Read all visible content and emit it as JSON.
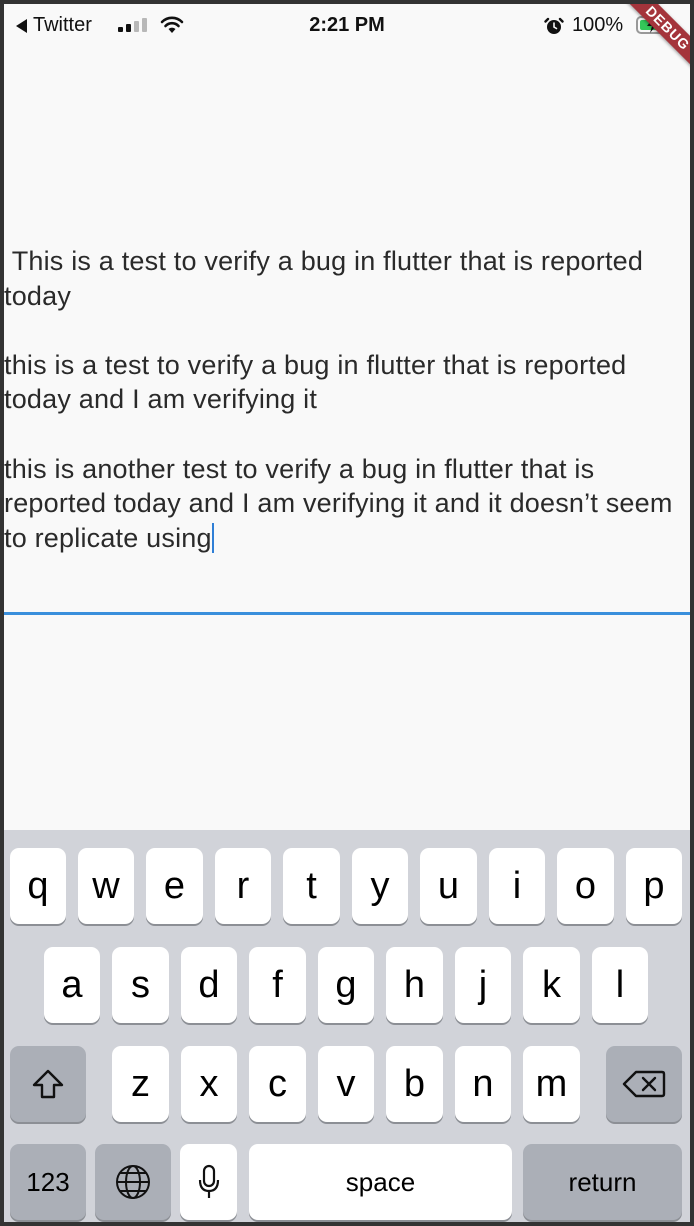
{
  "status_bar": {
    "back_app": "Twitter",
    "time": "2:21 PM",
    "battery_percent": "100%",
    "debug_label": "DEBUG"
  },
  "text_field": {
    "paragraph1": " This is a test to verify a bug in flutter that is reported today",
    "paragraph2": "this is a test to verify a bug in flutter that is reported today and I am verifying it",
    "paragraph3": "this is another test to verify a bug in flutter that is reported today and I am verifying it and it doesn’t seem to replicate using"
  },
  "keyboard": {
    "row1": [
      "q",
      "w",
      "e",
      "r",
      "t",
      "y",
      "u",
      "i",
      "o",
      "p"
    ],
    "row2": [
      "a",
      "s",
      "d",
      "f",
      "g",
      "h",
      "j",
      "k",
      "l"
    ],
    "row3": [
      "z",
      "x",
      "c",
      "v",
      "b",
      "n",
      "m"
    ],
    "numbers_label": "123",
    "space_label": "space",
    "return_label": "return"
  },
  "colors": {
    "accent": "#3a8fdc",
    "debug_banner": "#a4343b",
    "keyboard_bg": "#d1d3d9"
  }
}
